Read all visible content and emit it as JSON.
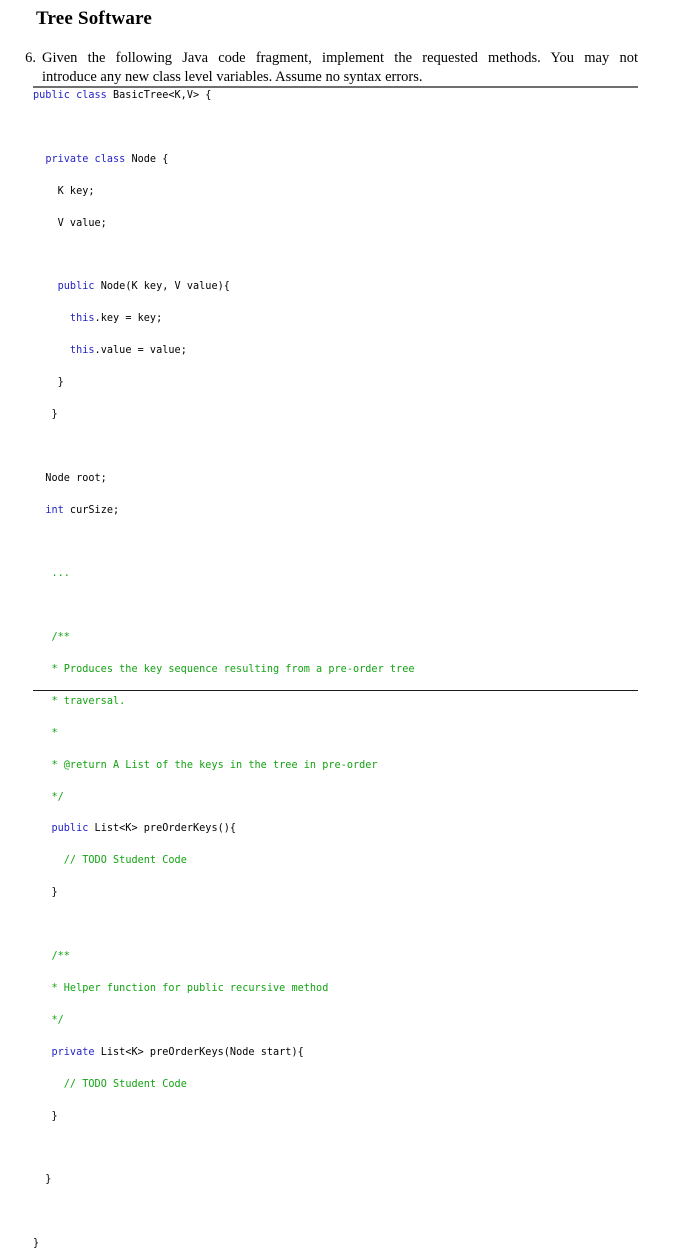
{
  "document": {
    "title": "Tree Software",
    "problem": {
      "number": "6.",
      "line1": "Given the following Java code fragment, implement the requested methods. You may not",
      "line2": "introduce any new class level variables. Assume no syntax errors."
    },
    "code": {
      "language": "java",
      "colors": {
        "keyword": "#2424c8",
        "comment": "#13a313",
        "plain": "#000000",
        "rule_top": "#6f6f72",
        "rule_bottom": "#1b1b1b"
      },
      "lines": [
        [
          {
            "t": "public class",
            "c": "kw"
          },
          {
            "t": " BasicTree<K,V> {",
            "c": "pln"
          }
        ],
        [
          {
            "t": "",
            "c": "pln"
          }
        ],
        [
          {
            "t": "  ",
            "c": "pln"
          },
          {
            "t": "private class",
            "c": "kw"
          },
          {
            "t": " Node {",
            "c": "pln"
          }
        ],
        [
          {
            "t": "    K key;",
            "c": "pln"
          }
        ],
        [
          {
            "t": "    V value;",
            "c": "pln"
          }
        ],
        [
          {
            "t": "",
            "c": "pln"
          }
        ],
        [
          {
            "t": "    ",
            "c": "pln"
          },
          {
            "t": "public",
            "c": "kw"
          },
          {
            "t": " Node(K key, V value){",
            "c": "pln"
          }
        ],
        [
          {
            "t": "      ",
            "c": "pln"
          },
          {
            "t": "this",
            "c": "kw"
          },
          {
            "t": ".key = key;",
            "c": "pln"
          }
        ],
        [
          {
            "t": "      ",
            "c": "pln"
          },
          {
            "t": "this",
            "c": "kw"
          },
          {
            "t": ".value = value;",
            "c": "pln"
          }
        ],
        [
          {
            "t": "    }",
            "c": "pln"
          }
        ],
        [
          {
            "t": "   }",
            "c": "pln"
          }
        ],
        [
          {
            "t": "",
            "c": "pln"
          }
        ],
        [
          {
            "t": "  Node root;",
            "c": "pln"
          }
        ],
        [
          {
            "t": "  ",
            "c": "pln"
          },
          {
            "t": "int",
            "c": "kw"
          },
          {
            "t": " curSize;",
            "c": "pln"
          }
        ],
        [
          {
            "t": "",
            "c": "pln"
          }
        ],
        [
          {
            "t": "   ...",
            "c": "cmt"
          }
        ],
        [
          {
            "t": "",
            "c": "pln"
          }
        ],
        [
          {
            "t": "   /**",
            "c": "cmt"
          }
        ],
        [
          {
            "t": "   * Produces the key sequence resulting from a pre-order tree",
            "c": "cmt"
          }
        ],
        [
          {
            "t": "   * traversal.",
            "c": "cmt"
          }
        ],
        [
          {
            "t": "   *",
            "c": "cmt"
          }
        ],
        [
          {
            "t": "   * @return A List of the keys in the tree in pre-order",
            "c": "cmt"
          }
        ],
        [
          {
            "t": "   */",
            "c": "cmt"
          }
        ],
        [
          {
            "t": "   ",
            "c": "pln"
          },
          {
            "t": "public",
            "c": "kw"
          },
          {
            "t": " List<K> preOrderKeys(){",
            "c": "pln"
          }
        ],
        [
          {
            "t": "     ",
            "c": "pln"
          },
          {
            "t": "// TODO Student Code",
            "c": "cmt"
          }
        ],
        [
          {
            "t": "   }",
            "c": "pln"
          }
        ],
        [
          {
            "t": "",
            "c": "pln"
          }
        ],
        [
          {
            "t": "   /**",
            "c": "cmt"
          }
        ],
        [
          {
            "t": "   * Helper function for public recursive method",
            "c": "cmt"
          }
        ],
        [
          {
            "t": "   */",
            "c": "cmt"
          }
        ],
        [
          {
            "t": "   ",
            "c": "pln"
          },
          {
            "t": "private",
            "c": "kw"
          },
          {
            "t": " List<K> preOrderKeys(Node start){",
            "c": "pln"
          }
        ],
        [
          {
            "t": "     ",
            "c": "pln"
          },
          {
            "t": "// TODO Student Code",
            "c": "cmt"
          }
        ],
        [
          {
            "t": "   }",
            "c": "pln"
          }
        ],
        [
          {
            "t": "",
            "c": "pln"
          }
        ],
        [
          {
            "t": "  }",
            "c": "pln"
          }
        ],
        [
          {
            "t": "",
            "c": "pln"
          }
        ],
        [
          {
            "t": "}",
            "c": "pln"
          }
        ]
      ]
    }
  }
}
